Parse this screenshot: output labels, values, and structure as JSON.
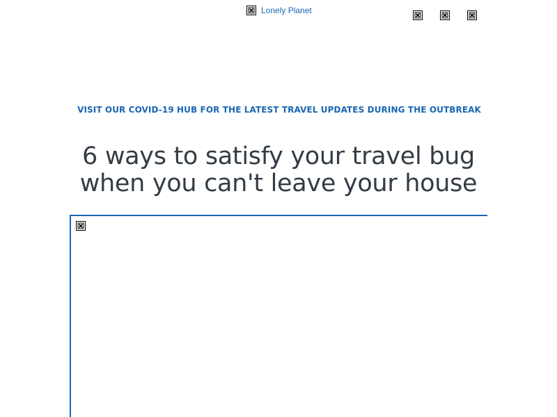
{
  "header": {
    "logo_alt": "Lonely Planet",
    "logo_icon": "broken-image-icon",
    "action_icons": [
      "broken-image-icon",
      "broken-image-icon",
      "broken-image-icon"
    ]
  },
  "banner": {
    "text": "VISIT OUR COVID-19 HUB FOR THE LATEST TRAVEL UPDATES DURING THE OUTBREAK"
  },
  "article": {
    "title": "6 ways to satisfy your travel bug when you can't leave your house",
    "hero_image_icon": "broken-image-icon"
  },
  "colors": {
    "accent": "#1a66b3",
    "heading": "#333c44",
    "background": "#ffffff"
  }
}
